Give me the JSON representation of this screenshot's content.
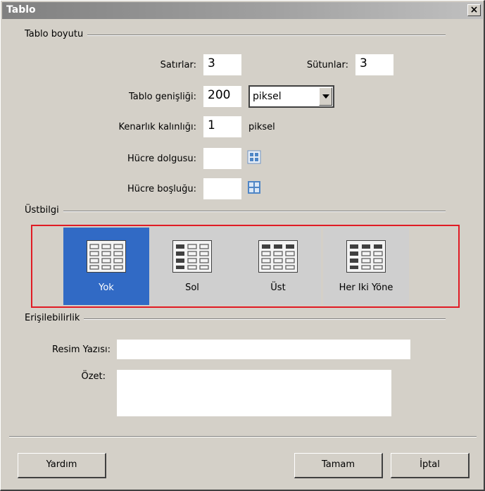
{
  "window": {
    "title": "Tablo",
    "close_label": "×"
  },
  "size_group": {
    "title": "Tablo boyutu",
    "rows_label": "Satırlar:",
    "rows_value": "3",
    "cols_label": "Sütunlar:",
    "cols_value": "3",
    "width_label": "Tablo genişliği:",
    "width_value": "200",
    "width_unit_selected": "piksel",
    "border_label": "Kenarlık kalınlığı:",
    "border_value": "1",
    "border_unit": "piksel",
    "padding_label": "Hücre dolgusu:",
    "padding_value": "",
    "spacing_label": "Hücre boşluğu:",
    "spacing_value": ""
  },
  "header_group": {
    "title": "Üstbilgi",
    "options": [
      {
        "label": "Yok",
        "icon": "table-no-header-icon",
        "selected": true
      },
      {
        "label": "Sol",
        "icon": "table-left-header-icon",
        "selected": false
      },
      {
        "label": "Üst",
        "icon": "table-top-header-icon",
        "selected": false
      },
      {
        "label": "Her Iki Yöne",
        "icon": "table-both-header-icon",
        "selected": false
      }
    ],
    "highlight_color": "#e01b24",
    "selected_color": "#316ac5"
  },
  "accessibility_group": {
    "title": "Erişilebilirlik",
    "caption_label": "Resim Yazısı:",
    "caption_value": "",
    "summary_label": "Özet:",
    "summary_value": ""
  },
  "buttons": {
    "help": "Yardım",
    "ok": "Tamam",
    "cancel": "İptal"
  }
}
